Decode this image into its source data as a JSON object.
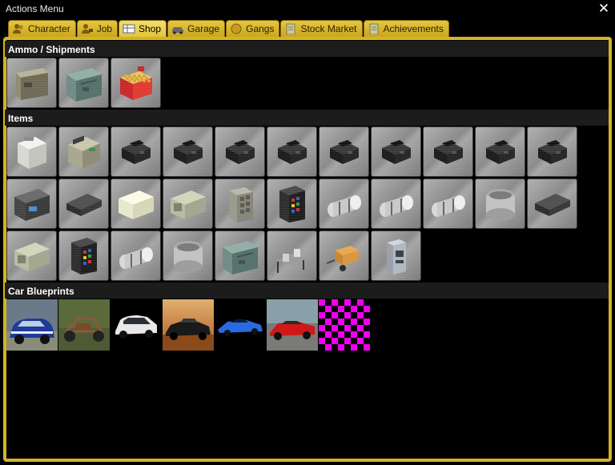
{
  "window": {
    "title": "Actions Menu",
    "close_glyph": "✕"
  },
  "tabs": [
    {
      "label": "Character",
      "icon": "character-icon",
      "active": false
    },
    {
      "label": "Job",
      "icon": "job-icon",
      "active": false
    },
    {
      "label": "Shop",
      "icon": "shop-icon",
      "active": true
    },
    {
      "label": "Garage",
      "icon": "car-icon",
      "active": false
    },
    {
      "label": "Gangs",
      "icon": "gang-icon",
      "active": false
    },
    {
      "label": "Stock Market",
      "icon": "document-icon",
      "active": false
    },
    {
      "label": "Achievements",
      "icon": "document-icon",
      "active": false
    }
  ],
  "sections": {
    "ammo": {
      "title": "Ammo / Shipments",
      "items": [
        "ammo-box-icon",
        "ammo-crate-icon",
        "shotgun-shells-icon"
      ]
    },
    "items": {
      "title": "Items",
      "items": [
        "washing-machine-icon",
        "money-printer-icon",
        "money-printer-black-icon",
        "money-printer-black-icon",
        "money-printer-black-icon",
        "money-printer-black-icon",
        "money-printer-black-icon",
        "money-printer-black-icon",
        "money-printer-black-icon",
        "money-printer-black-icon",
        "money-printer-black-icon",
        "radio-icon",
        "dvd-player-icon",
        "microwave-white-icon",
        "microwave-icon",
        "cabinet-icon",
        "vending-machine-icon",
        "gas-canister-icon",
        "gas-canister-icon",
        "gas-canister-icon",
        "cooking-pot-icon",
        "dvd-player-icon",
        "microwave-icon",
        "vending-machine-icon",
        "gas-canister-icon",
        "cooking-pot-icon",
        "ammo-crate-icon",
        "drug-lab-icon",
        "generator-cart-icon",
        "fuel-pump-icon"
      ]
    },
    "blueprints": {
      "title": "Car Blueprints",
      "items": [
        "mini-cooper-blueprint",
        "buggy-blueprint",
        "white-hatchback-blueprint",
        "black-muscle-car-blueprint",
        "blue-sports-car-blueprint",
        "red-sports-car-blueprint",
        "missing-texture-blueprint"
      ]
    }
  },
  "colors": {
    "accent": "#d4b324",
    "tab": "#e0c13a",
    "header": "#1c1c1c",
    "background": "#000000"
  }
}
